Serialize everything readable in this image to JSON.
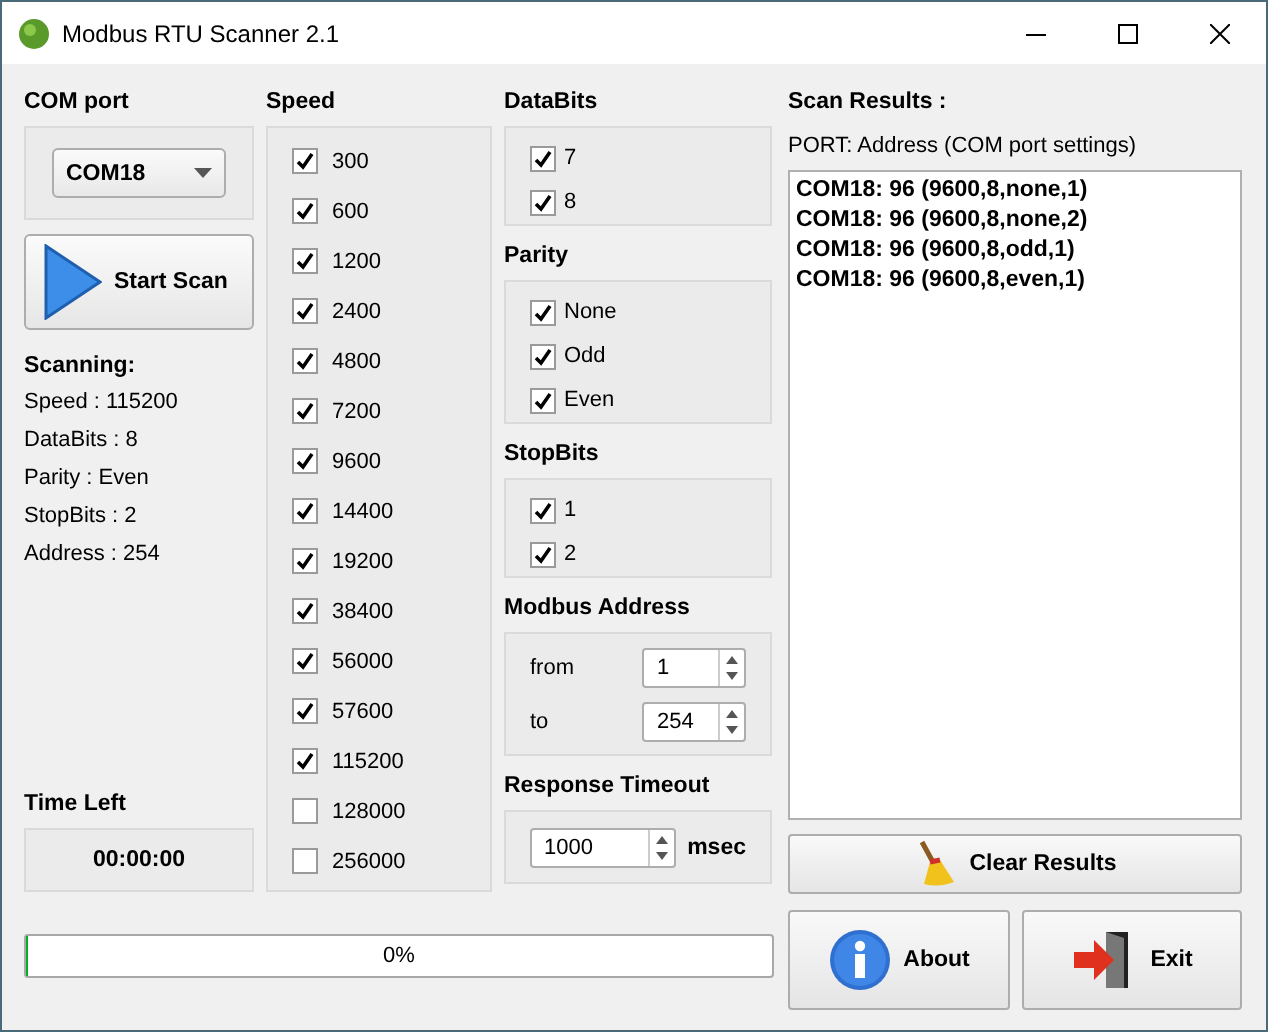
{
  "window": {
    "title": "Modbus RTU Scanner 2.1"
  },
  "com_port": {
    "label": "COM port",
    "value": "COM18"
  },
  "start_button": {
    "label": "Start Scan"
  },
  "scanning": {
    "title": "Scanning:",
    "lines": [
      "Speed : 115200",
      "DataBits : 8",
      "Parity : Even",
      "StopBits : 2",
      "Address : 254"
    ]
  },
  "time_left": {
    "label": "Time Left",
    "value": "00:00:00"
  },
  "speed": {
    "label": "Speed",
    "options": [
      {
        "label": "300",
        "checked": true
      },
      {
        "label": "600",
        "checked": true
      },
      {
        "label": "1200",
        "checked": true
      },
      {
        "label": "2400",
        "checked": true
      },
      {
        "label": "4800",
        "checked": true
      },
      {
        "label": "7200",
        "checked": true
      },
      {
        "label": "9600",
        "checked": true
      },
      {
        "label": "14400",
        "checked": true
      },
      {
        "label": "19200",
        "checked": true
      },
      {
        "label": "38400",
        "checked": true
      },
      {
        "label": "56000",
        "checked": true
      },
      {
        "label": "57600",
        "checked": true
      },
      {
        "label": "115200",
        "checked": true
      },
      {
        "label": "128000",
        "checked": false
      },
      {
        "label": "256000",
        "checked": false
      }
    ]
  },
  "databits": {
    "label": "DataBits",
    "options": [
      {
        "label": "7",
        "checked": true
      },
      {
        "label": "8",
        "checked": true
      }
    ]
  },
  "parity": {
    "label": "Parity",
    "options": [
      {
        "label": "None",
        "checked": true
      },
      {
        "label": "Odd",
        "checked": true
      },
      {
        "label": "Even",
        "checked": true
      }
    ]
  },
  "stopbits": {
    "label": "StopBits",
    "options": [
      {
        "label": "1",
        "checked": true
      },
      {
        "label": "2",
        "checked": true
      }
    ]
  },
  "modbus_address": {
    "label": "Modbus Address",
    "fields": [
      {
        "label": "from",
        "value": "1"
      },
      {
        "label": "to",
        "value": "254"
      }
    ]
  },
  "response_timeout": {
    "label": "Response Timeout",
    "value": "1000",
    "unit": "msec"
  },
  "progress": {
    "level": 0,
    "text": "0%"
  },
  "scan_results": {
    "label": "Scan Results :",
    "hint": "PORT: Address (COM port settings)",
    "lines": [
      "COM18: 96 (9600,8,none,1)",
      "COM18: 96 (9600,8,none,2)",
      "COM18: 96 (9600,8,odd,1)",
      "COM18: 96 (9600,8,even,1)"
    ]
  },
  "buttons": [
    {
      "kind": "clear",
      "label": "Clear Results"
    },
    {
      "kind": "about",
      "label": "About"
    },
    {
      "kind": "exit",
      "label": "Exit"
    }
  ]
}
